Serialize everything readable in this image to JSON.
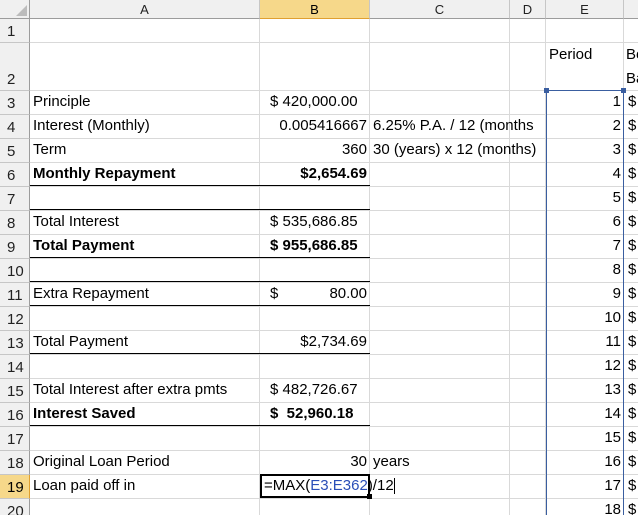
{
  "columns": [
    "A",
    "B",
    "C",
    "D",
    "E"
  ],
  "rows": [
    "1",
    "2",
    "3",
    "4",
    "5",
    "6",
    "7",
    "8",
    "9",
    "10",
    "11",
    "12",
    "13",
    "14",
    "15",
    "16",
    "17",
    "18",
    "19",
    "20"
  ],
  "headers": {
    "period": "Period",
    "next_line1": "Be",
    "next_line2": "Ba"
  },
  "cells": {
    "a3": "Principle",
    "b3": "$ 420,000.00",
    "a4": "Interest (Monthly)",
    "b4": "0.005416667",
    "c4": "6.25% P.A. / 12 (months",
    "a5": "Term",
    "b5": "360",
    "c5": "30 (years) x 12 (months)",
    "a6": "Monthly Repayment",
    "b6": "$2,654.69",
    "a8": "Total Interest",
    "b8": "$ 535,686.85",
    "a9": "Total Payment",
    "b9": "$ 955,686.85",
    "a11": "Extra Repayment",
    "b11_sym": "$",
    "b11": "80.00",
    "a13": "Total Payment",
    "b13": "$2,734.69",
    "a15": "Total Interest after extra pmts",
    "b15": "$ 482,726.67",
    "a16": "Interest Saved",
    "b16": "$  52,960.18",
    "a18": "Original Loan Period",
    "b18": "30",
    "c18": "years",
    "a19": "Loan paid off in"
  },
  "formula": {
    "prefix": "=MAX(",
    "ref": "E3:E362",
    "suffix": ")/12"
  },
  "periods": [
    "1",
    "2",
    "3",
    "4",
    "5",
    "6",
    "7",
    "8",
    "9",
    "10",
    "11",
    "12",
    "13",
    "14",
    "15",
    "16",
    "17",
    "18"
  ],
  "dollar": "$",
  "colors": {
    "selected_header": "#f6d88a",
    "range_border": "#3a5ea0",
    "formula_ref": "#2b4fb8"
  }
}
